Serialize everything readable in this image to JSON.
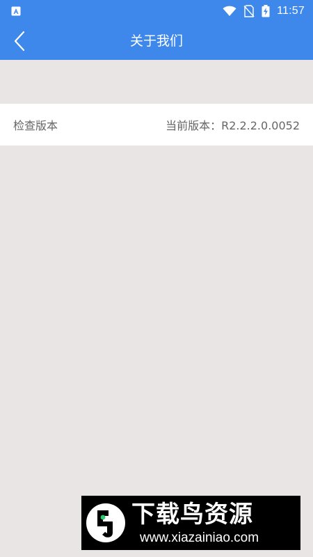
{
  "status_bar": {
    "time": "11:57",
    "icons": [
      "accessibility-a-icon",
      "wifi-icon",
      "no-sim-icon",
      "battery-charging-icon"
    ]
  },
  "app_bar": {
    "title": "关于我们",
    "back_icon": "chevron-left-icon"
  },
  "version_row": {
    "label": "检查版本",
    "current_version": "当前版本：R2.2.2.0.0052"
  },
  "watermark": {
    "title": "下载鸟资源",
    "url": "www.xiazainiao.com"
  },
  "colors": {
    "primary": "#3e88ec",
    "background": "#e9e5e4",
    "text_secondary": "#666666",
    "watermark_bg": "#000000"
  }
}
